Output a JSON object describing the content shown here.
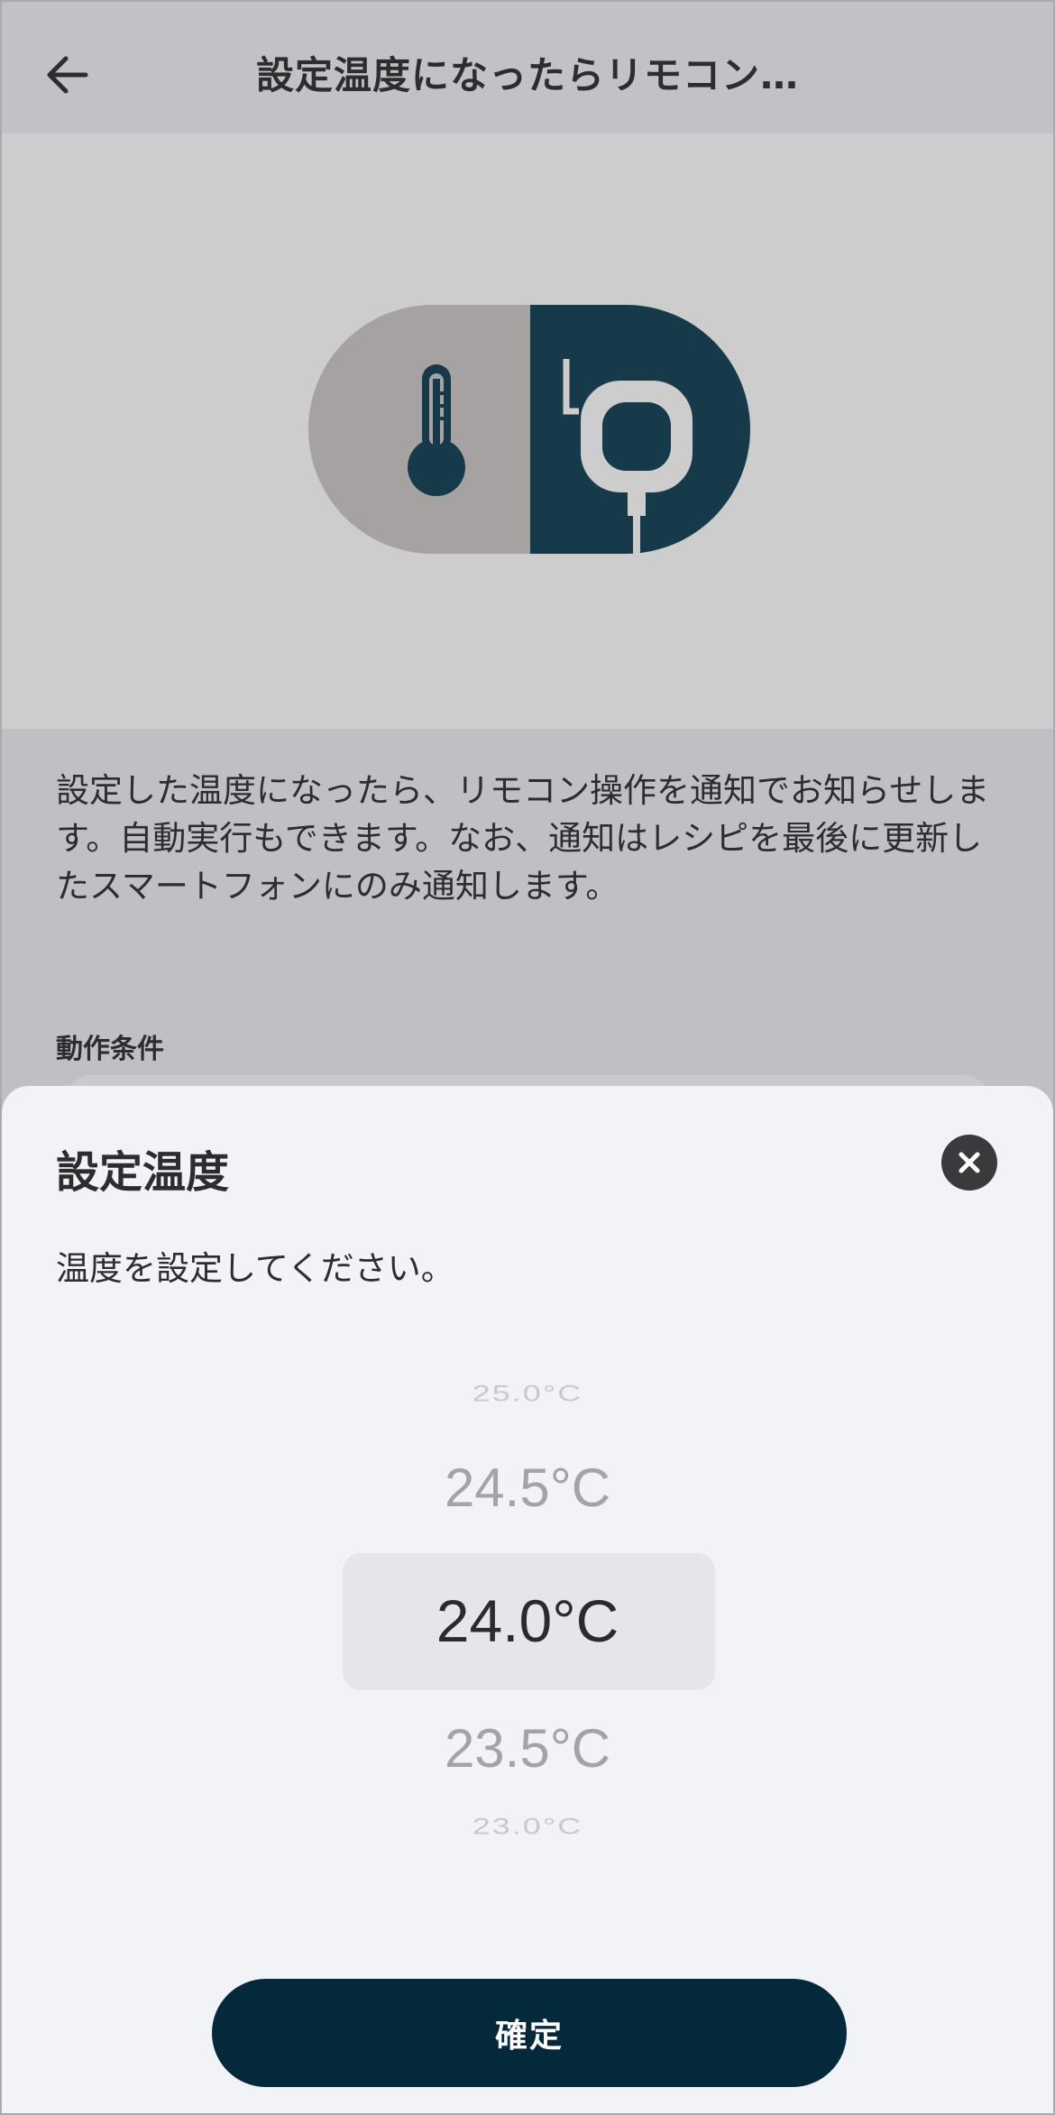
{
  "header": {
    "title": "設定温度になったらリモコン…",
    "back_icon": "arrow-left-icon"
  },
  "hero": {
    "thermometer_icon": "thermometer-icon",
    "remote_icon": "remote-controller-icon",
    "colors": {
      "left": "#a6a2a1",
      "right": "#163a4a"
    }
  },
  "description": "設定した温度になったら、リモコン操作を通知でお知らせします。自動実行もできます。なお、通知はレシピを最後に更新したスマートフォンにのみ通知します。",
  "section": {
    "label": "動作条件"
  },
  "sheet": {
    "title": "設定温度",
    "close_icon": "close-icon",
    "instruction": "温度を設定してください。",
    "picker": {
      "options": [
        "25.0°C",
        "24.5°C",
        "24.0°C",
        "23.5°C",
        "23.0°C"
      ],
      "selected": "24.0°C"
    },
    "confirm_label": "確定"
  },
  "colors": {
    "accent": "#04293b"
  }
}
